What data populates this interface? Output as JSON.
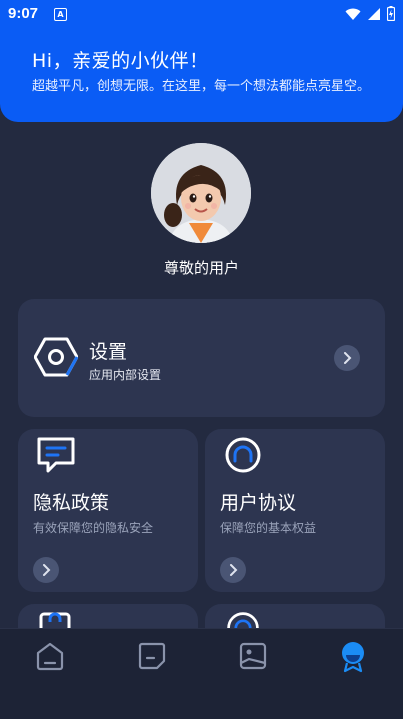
{
  "status_bar": {
    "time": "9:07",
    "notification_letter": "A",
    "icons": [
      "wifi-icon",
      "signal-icon",
      "battery-icon"
    ]
  },
  "header": {
    "title": "Hi，亲爱的小伙伴！",
    "subtitle": "超越平凡，创想无限。在这里，每一个想法都能点亮星空。"
  },
  "profile": {
    "username": "尊敬的用户"
  },
  "settings": {
    "title": "设置",
    "subtitle": "应用内部设置"
  },
  "cards": [
    {
      "title": "隐私政策",
      "subtitle": "有效保障您的隐私安全",
      "icon": "message-icon"
    },
    {
      "title": "用户协议",
      "subtitle": "保障您的基本权益",
      "icon": "headset-icon"
    }
  ],
  "bottom_cards": [
    {
      "icon": "bag-icon"
    },
    {
      "icon": "headset-icon"
    }
  ],
  "nav": {
    "items": [
      "home-icon",
      "note-icon",
      "gallery-icon",
      "profile-icon"
    ],
    "active_index": 3
  },
  "colors": {
    "accent": "#0a5cf5",
    "background": "#232a40",
    "card": "#2d3550",
    "nav_background": "#1d2336",
    "active_nav": "#1b8cf5"
  }
}
